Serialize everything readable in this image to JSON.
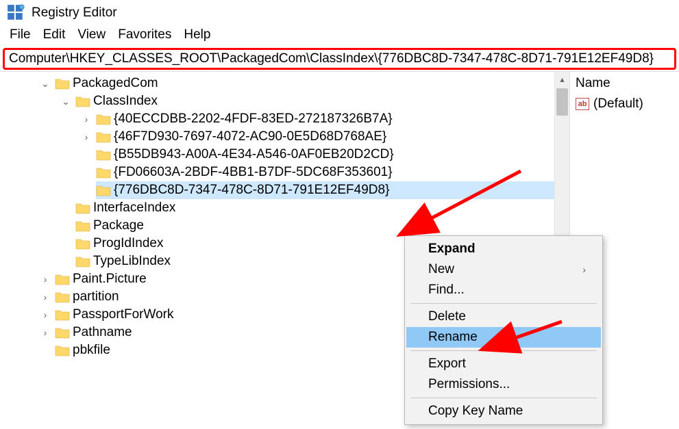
{
  "app": {
    "title": "Registry Editor"
  },
  "menu": {
    "file": "File",
    "edit": "Edit",
    "view": "View",
    "favorites": "Favorites",
    "help": "Help"
  },
  "address": {
    "value": "Computer\\HKEY_CLASSES_ROOT\\PackagedCom\\ClassIndex\\{776DBC8D-7347-478C-8D71-791E12EF49D8}"
  },
  "tree": {
    "packagedcom": "PackagedCom",
    "classindex": "ClassIndex",
    "guid1": "{40ECCDBB-2202-4FDF-83ED-272187326B7A}",
    "guid2": "{46F7D930-7697-4072-AC90-0E5D68D768AE}",
    "guid3": "{B55DB943-A00A-4E34-A546-0AF0EB20D2CD}",
    "guid4": "{FD06603A-2BDF-4BB1-B7DF-5DC68F353601}",
    "guid5": "{776DBC8D-7347-478C-8D71-791E12EF49D8}",
    "interfaceindex": "InterfaceIndex",
    "package": "Package",
    "progidindex": "ProgIdIndex",
    "typelibindex": "TypeLibIndex",
    "paintpicture": "Paint.Picture",
    "partition": "partition",
    "passportforwork": "PassportForWork",
    "pathname": "Pathname",
    "pbkfile": "pbkfile"
  },
  "right": {
    "header": "Name",
    "default": "(Default)"
  },
  "ctx": {
    "expand": "Expand",
    "new": "New",
    "find": "Find...",
    "delete": "Delete",
    "rename": "Rename",
    "export": "Export",
    "permissions": "Permissions...",
    "copykeyname": "Copy Key Name"
  }
}
